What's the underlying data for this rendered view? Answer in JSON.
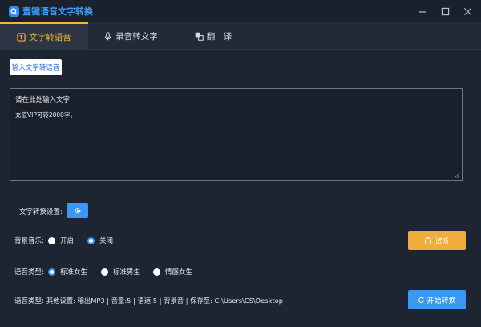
{
  "window": {
    "title": "壹键语音文字转换",
    "controls": [
      "minimize",
      "maximize",
      "close"
    ]
  },
  "tabs": [
    {
      "label": "文字转语音",
      "icon": "text-to-speech-icon",
      "active": true
    },
    {
      "label": "录音转文字",
      "icon": "microphone-icon",
      "active": false
    },
    {
      "label": "翻　译",
      "icon": "translate-icon",
      "active": false
    }
  ],
  "input_button": {
    "label": "输入文字转语音"
  },
  "editor": {
    "placeholder": "请在此处输入文字",
    "note": "充值VIP可转2000字。"
  },
  "conversion_settings": {
    "label": "文字转换设置:",
    "button_icon": "gear-icon"
  },
  "bg_music": {
    "label": "背景音乐:",
    "options": [
      {
        "label": "开启",
        "checked": false
      },
      {
        "label": "关闭",
        "checked": true
      }
    ]
  },
  "voice_type": {
    "label": "语音类型:",
    "options": [
      {
        "label": "标准女生",
        "checked": true
      },
      {
        "label": "标准男生",
        "checked": false
      },
      {
        "label": "情感女生",
        "checked": false
      }
    ]
  },
  "status_line": {
    "label": "语音类型:",
    "text": "其他设置:  输出MP3 |  音量:5 |  语速:5 |  背景音 |  保存至:  C:\\Users\\CS\\Desktop"
  },
  "buttons": {
    "preview": "试听",
    "start": "开始转换"
  },
  "colors": {
    "accent_blue": "#3a97f2",
    "accent_orange": "#f0ad3e",
    "tab_active": "#f1b73c",
    "background": "#1e2532"
  }
}
